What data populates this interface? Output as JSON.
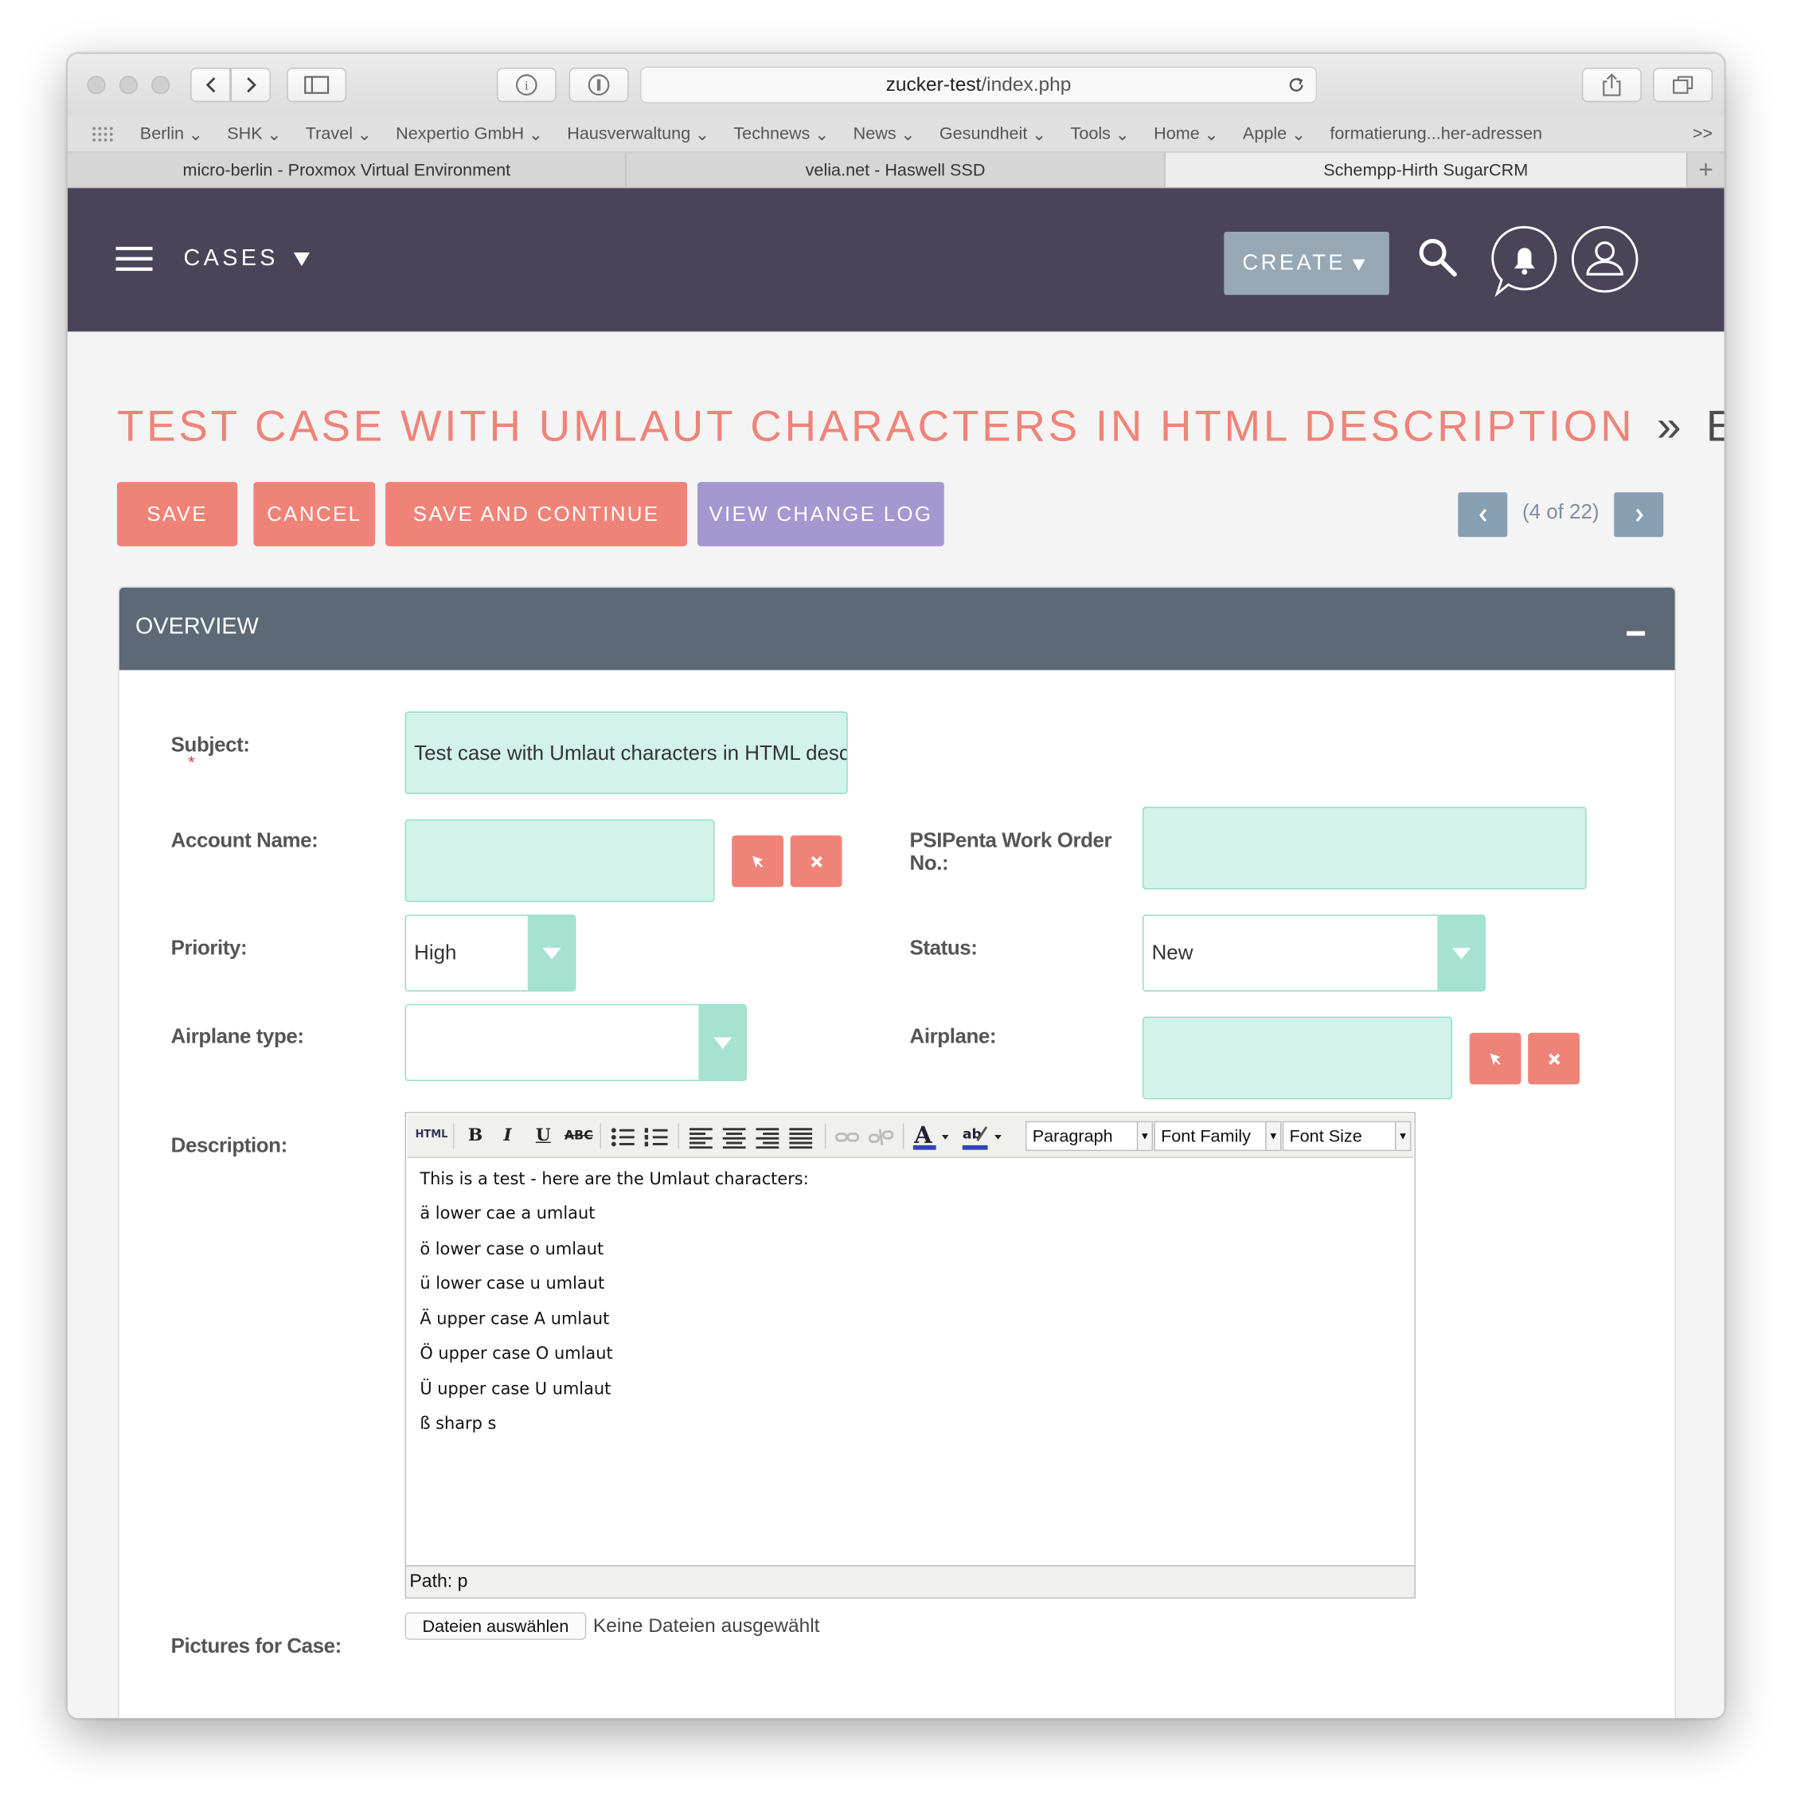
{
  "browser": {
    "url_host": "zucker-test",
    "url_path": "/index.php",
    "bookmarks": [
      "Berlin",
      "SHK",
      "Travel",
      "Nexpertio GmbH",
      "Hausverwaltung",
      "Technews",
      "News",
      "Gesundheit",
      "Tools",
      "Home",
      "Apple",
      "formatierung...her-adressen"
    ],
    "bookmarks_overflow": ">>",
    "tabs": [
      {
        "title": "micro-berlin - Proxmox Virtual Environment"
      },
      {
        "title": "velia.net - Haswell SSD"
      },
      {
        "title": "Schempp-Hirth SugarCRM",
        "active": true
      }
    ]
  },
  "nav": {
    "module": "CASES",
    "create_label": "CREATE"
  },
  "page": {
    "record_title": "TEST CASE WITH UMLAUT CHARACTERS IN HTML DESCRIPTION",
    "separator": "»",
    "mode": "EDIT",
    "pager": "(4 of 22)"
  },
  "actions": {
    "save": "SAVE",
    "cancel": "CANCEL",
    "save_continue": "SAVE AND CONTINUE",
    "view_change_log": "VIEW CHANGE LOG"
  },
  "panel": {
    "title": "OVERVIEW",
    "collapse": "−"
  },
  "form": {
    "subject": {
      "label": "Subject:",
      "required_mark": "*",
      "value": "Test case with Umlaut characters in HTML desc"
    },
    "account_name": {
      "label": "Account Name:",
      "value": ""
    },
    "psipenta": {
      "label_line1": "PSIPenta Work Order",
      "label_line2": "No.:",
      "value": ""
    },
    "priority": {
      "label": "Priority:",
      "value": "High"
    },
    "status": {
      "label": "Status:",
      "value": "New"
    },
    "airplane_type": {
      "label": "Airplane type:",
      "value": ""
    },
    "airplane": {
      "label": "Airplane:",
      "value": ""
    },
    "description": {
      "label": "Description:",
      "toolbar": {
        "html": "HTML",
        "bold": "B",
        "italic": "I",
        "underline": "U",
        "strike": "ABC",
        "format": "Paragraph",
        "font_family": "Font Family",
        "font_size": "Font Size"
      },
      "lines": [
        "This is a test - here are the Umlaut characters:",
        "ä lower cae a umlaut",
        "ö lower case o umlaut",
        "ü lower case u umlaut",
        "Ä upper case A umlaut",
        "Ö upper case O umlaut",
        "Ü upper case U umlaut",
        "ß sharp s"
      ],
      "path": "Path: p"
    },
    "pictures": {
      "label": "Pictures for Case:",
      "button": "Dateien auswählen",
      "status": "Keine Dateien ausgewählt"
    }
  },
  "colors": {
    "header": "#4a4459",
    "accent_red": "#f08378",
    "accent_purple": "#a597cf",
    "panel_header": "#5d6977",
    "input_fill": "#d3f2ea",
    "input_border": "#8fdcc4"
  },
  "icons": [
    "hamburger-menu-icon",
    "triangle-down-icon",
    "search-icon",
    "bell-icon",
    "user-icon",
    "arrow-select-icon",
    "clear-x-icon",
    "chevron-left-icon",
    "chevron-right-icon"
  ]
}
